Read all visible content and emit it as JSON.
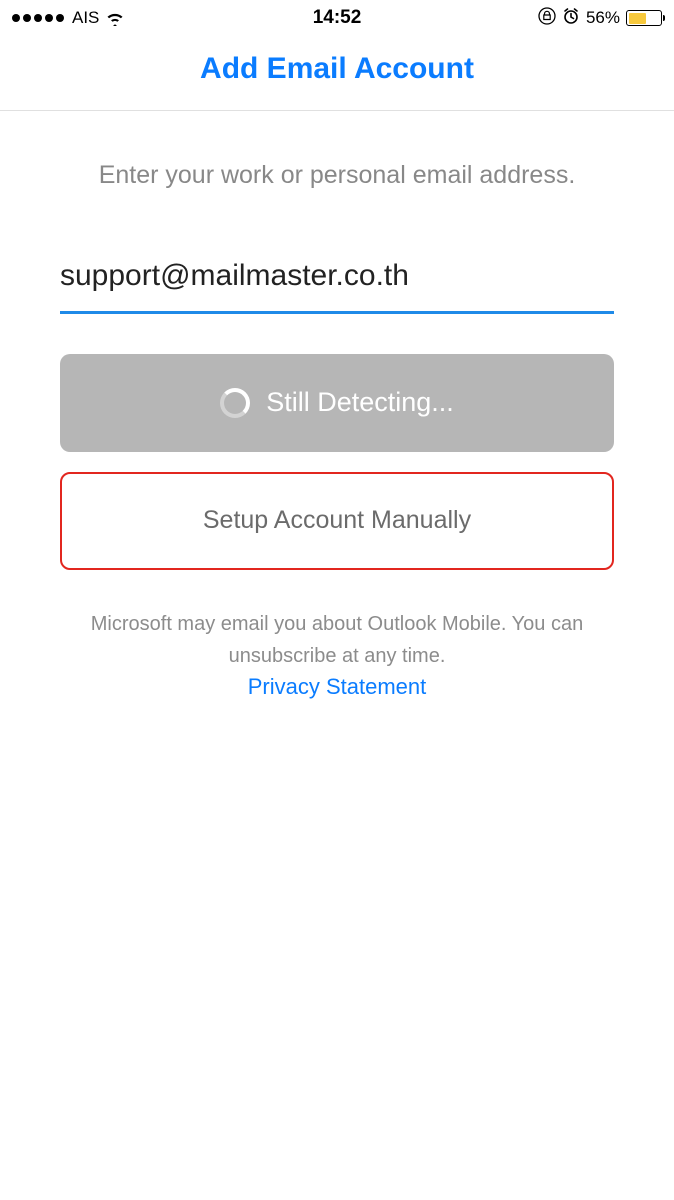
{
  "statusBar": {
    "carrier": "AIS",
    "time": "14:52",
    "batteryPercent": "56%"
  },
  "header": {
    "title": "Add Email Account"
  },
  "main": {
    "instruction": "Enter your work or personal email address.",
    "emailValue": "support@mailmaster.co.th",
    "detectingLabel": "Still Detecting...",
    "manualLabel": "Setup Account Manually",
    "disclaimer": "Microsoft may email you about Outlook Mobile. You can unsubscribe at any time.",
    "privacyLabel": "Privacy Statement"
  },
  "colors": {
    "accent": "#0a7cff",
    "highlightBorder": "#e2261f",
    "inputUnderline": "#1f8ae8",
    "batteryFill": "#f7c93d"
  }
}
